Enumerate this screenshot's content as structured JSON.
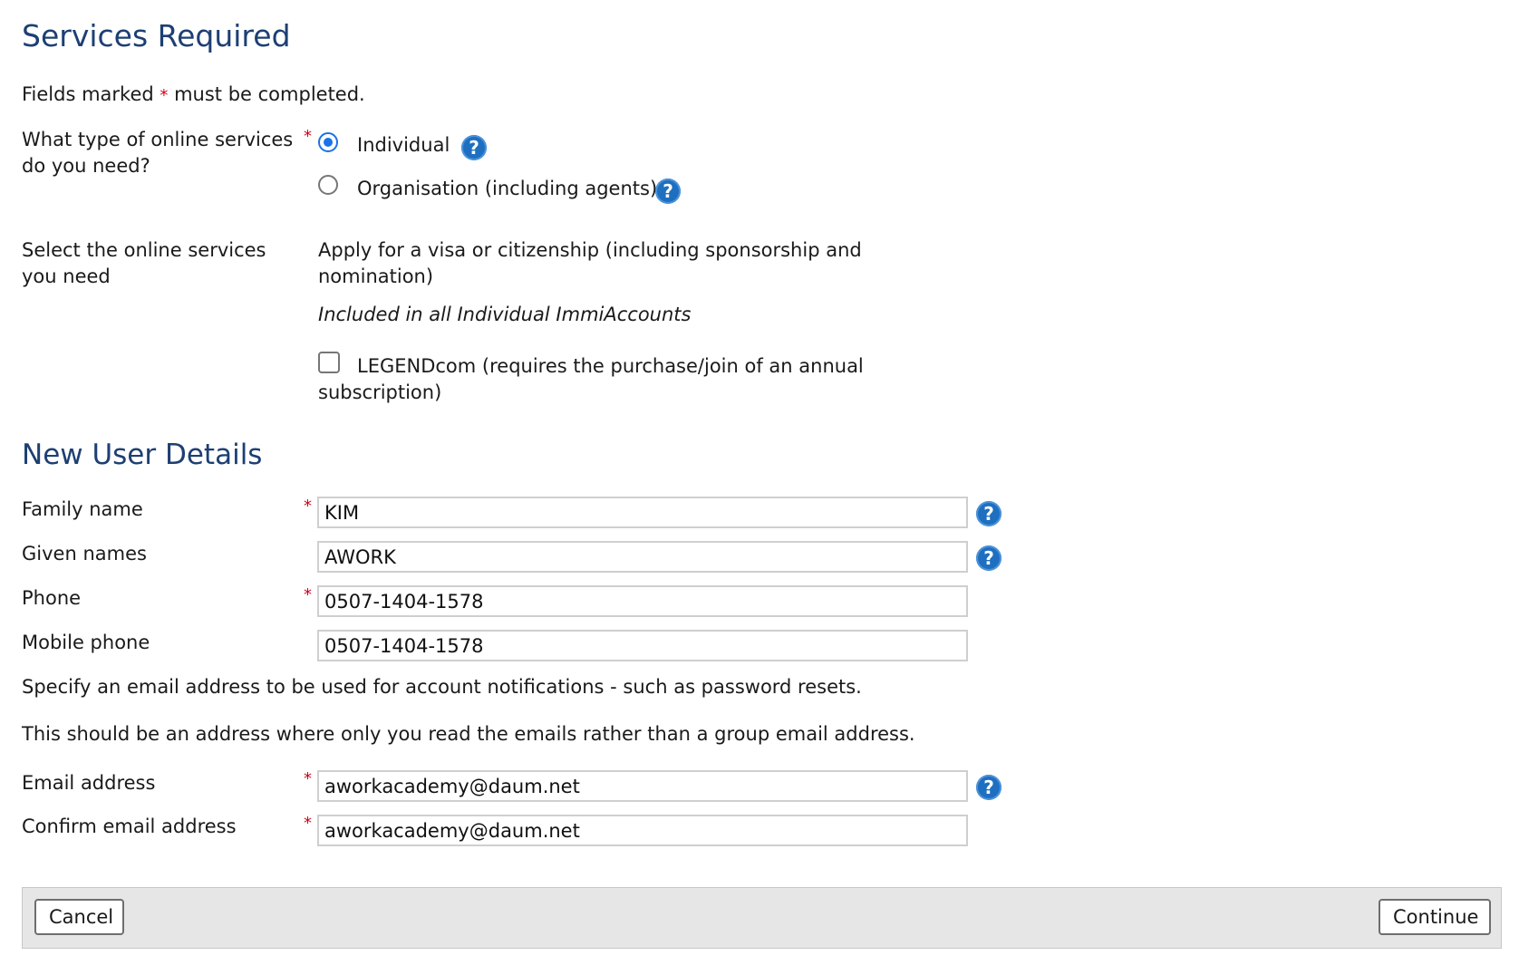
{
  "services": {
    "heading": "Services Required",
    "required_note_before": "Fields marked",
    "required_marker": "*",
    "required_note_after": "must be completed.",
    "type_question": "What type of online services do you need?",
    "type_options": [
      {
        "label": "Individual",
        "selected": true
      },
      {
        "label": "Organisation (including agents)",
        "selected": false
      }
    ],
    "select_label": "Select the online services you need",
    "visa_text": "Apply for a visa or citizenship (including sponsorship and nomination)",
    "included_note": "Included in all Individual ImmiAccounts",
    "legendcom_label": "LEGENDcom (requires the purchase/join of an annual subscription)",
    "legendcom_checked": false
  },
  "user": {
    "heading": "New User Details",
    "family_name_label": "Family name",
    "family_name_value": "KIM",
    "given_names_label": "Given names",
    "given_names_value": "AWORK",
    "phone_label": "Phone",
    "phone_value": "0507-1404-1578",
    "mobile_label": "Mobile phone",
    "mobile_value": "0507-1404-1578",
    "email_note_1": "Specify an email address to be used for account notifications - such as password resets.",
    "email_note_2": "This should be an address where only you read the emails rather than a group email address.",
    "email_label": "Email address",
    "email_value": "aworkacademy@daum.net",
    "confirm_email_label": "Confirm email address",
    "confirm_email_value": "aworkacademy@daum.net"
  },
  "help_glyph": "?",
  "footer": {
    "cancel_label": "Cancel",
    "continue_label": "Continue"
  },
  "colors": {
    "heading": "#1d3f73",
    "required": "#d0021b",
    "help_icon": "#1e6fc0",
    "radio_selected": "#1a73e8",
    "footer_bg": "#e6e6e6"
  }
}
